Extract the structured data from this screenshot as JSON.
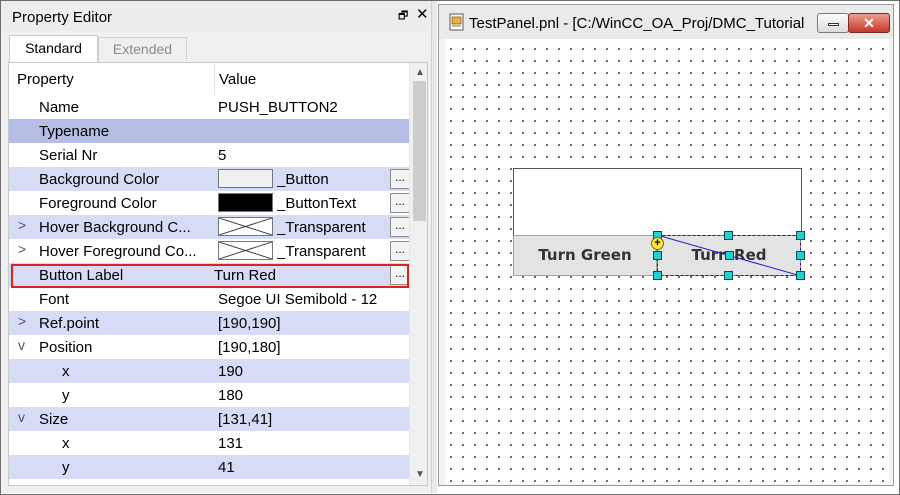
{
  "property_editor": {
    "title": "Property Editor",
    "restore_glyph": "🗗",
    "close_glyph": "✕",
    "tabs": [
      {
        "label": "Standard",
        "active": true
      },
      {
        "label": "Extended",
        "active": false
      }
    ],
    "columns": {
      "property": "Property",
      "value": "Value"
    },
    "rows": [
      {
        "name": "Name",
        "value": "PUSH_BUTTON2"
      },
      {
        "name": "Typename",
        "value": ""
      },
      {
        "name": "Serial Nr",
        "value": "5"
      },
      {
        "name": "Background Color",
        "value": "_Button"
      },
      {
        "name": "Foreground Color",
        "value": "_ButtonText"
      },
      {
        "name": "Hover Background C...",
        "value": "_Transparent"
      },
      {
        "name": "Hover Foreground Co...",
        "value": "_Transparent"
      },
      {
        "name": "Button Label",
        "value": "Turn Red"
      },
      {
        "name": "Font",
        "value": "Segoe UI Semibold - 12"
      },
      {
        "name": "Ref.point",
        "value": "[190,190]"
      },
      {
        "name": "Position",
        "value": "[190,180]"
      },
      {
        "name": "x",
        "value": "190"
      },
      {
        "name": "y",
        "value": "180"
      },
      {
        "name": "Size",
        "value": "[131,41]"
      },
      {
        "name": "x",
        "value": "131"
      },
      {
        "name": "y",
        "value": "41"
      }
    ],
    "ellipsis": "...",
    "expand_glyph": ">",
    "collapse_glyph": "v",
    "highlight_color": "#e02020"
  },
  "panel_window": {
    "title": "TestPanel.pnl - [C:/WinCC_OA_Proj/DMC_Tutorial",
    "minimize_icon": "minimize-icon",
    "close_glyph": "✕",
    "buttons": {
      "green_label": "Turn Green",
      "red_label": "Turn Red"
    },
    "selection_color": "#21d1cf",
    "ref_point_glyph": "+"
  }
}
